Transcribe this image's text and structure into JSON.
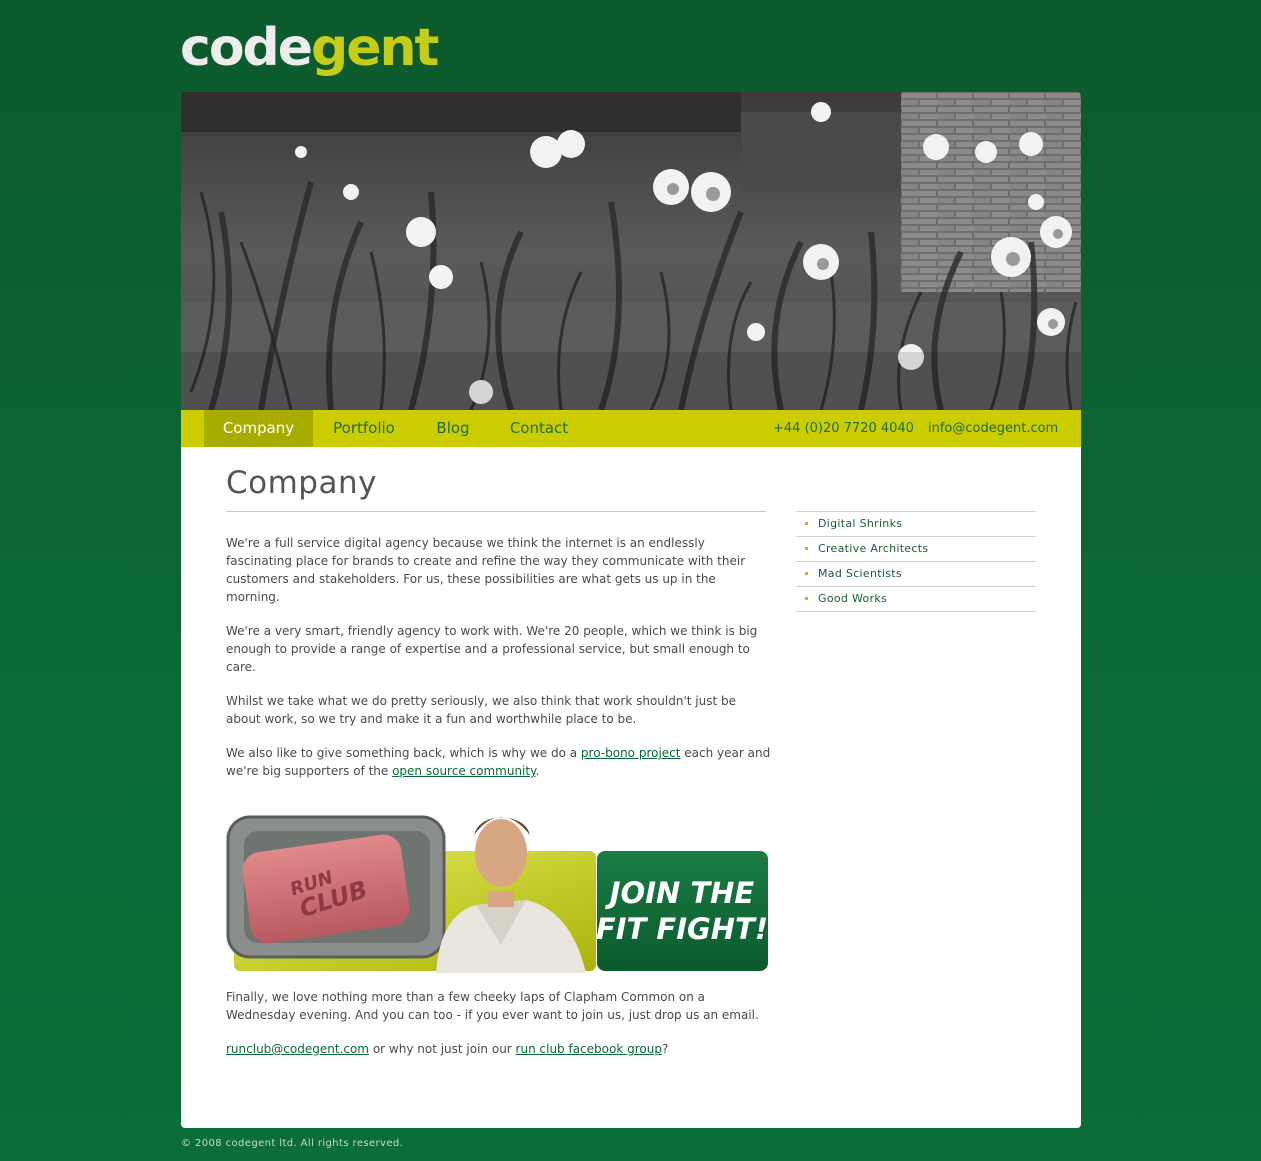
{
  "brand": {
    "logo_part1": "code",
    "logo_part2": "gent"
  },
  "nav": {
    "items": [
      {
        "label": "Company"
      },
      {
        "label": "Portfolio"
      },
      {
        "label": "Blog"
      },
      {
        "label": "Contact"
      }
    ],
    "phone": "+44 (0)20 7720 4040",
    "email": "info@codegent.com"
  },
  "page": {
    "title": "Company",
    "p1": "We're a full service digital agency because we think the internet is an endlessly fascinating place for brands to create and refine the way they communicate with their customers and stakeholders. For us, these possibilities are what gets us up in the morning.",
    "p2": "We're a very smart, friendly agency to work with. We're 20 people, which we think is big enough to provide a range of expertise and a professional service, but small enough to care.",
    "p3": "Whilst we take what we do pretty seriously, we also think that work shouldn't just be about work, so we try and make it a fun and worthwhile place to be.",
    "p4_a": "We also like to give something back, which is why we do a ",
    "p4_link1": "pro-bono project",
    "p4_b": " each year and we're big supporters of the ",
    "p4_link2": "open source community",
    "p4_c": ".",
    "p5": "Finally, we love nothing more than a few cheeky laps of Clapham Common on a Wednesday evening. And you can too - if you ever want to join us, just drop us an email.",
    "p6_link1": "runclub@codegent.com",
    "p6_a": " or why not just join our ",
    "p6_link2": "run club facebook group",
    "p6_b": "?"
  },
  "promo": {
    "soap_text_1": "RUN",
    "soap_text_2": "CLUB",
    "cta_line1": "JOIN THE",
    "cta_line2": "FIT FIGHT!"
  },
  "sidebar": {
    "items": [
      {
        "label": "Digital Shrinks"
      },
      {
        "label": "Creative Architects"
      },
      {
        "label": "Mad Scientists"
      },
      {
        "label": "Good Works"
      }
    ]
  },
  "footer": {
    "copyright": "© 2008 codegent ltd. All rights reserved."
  },
  "colors": {
    "background": "#0b6a36",
    "accent": "#cccd00",
    "nav_active": "#a9ac00",
    "link": "#0b6a36",
    "logo_gent": "#c6cc1a"
  }
}
